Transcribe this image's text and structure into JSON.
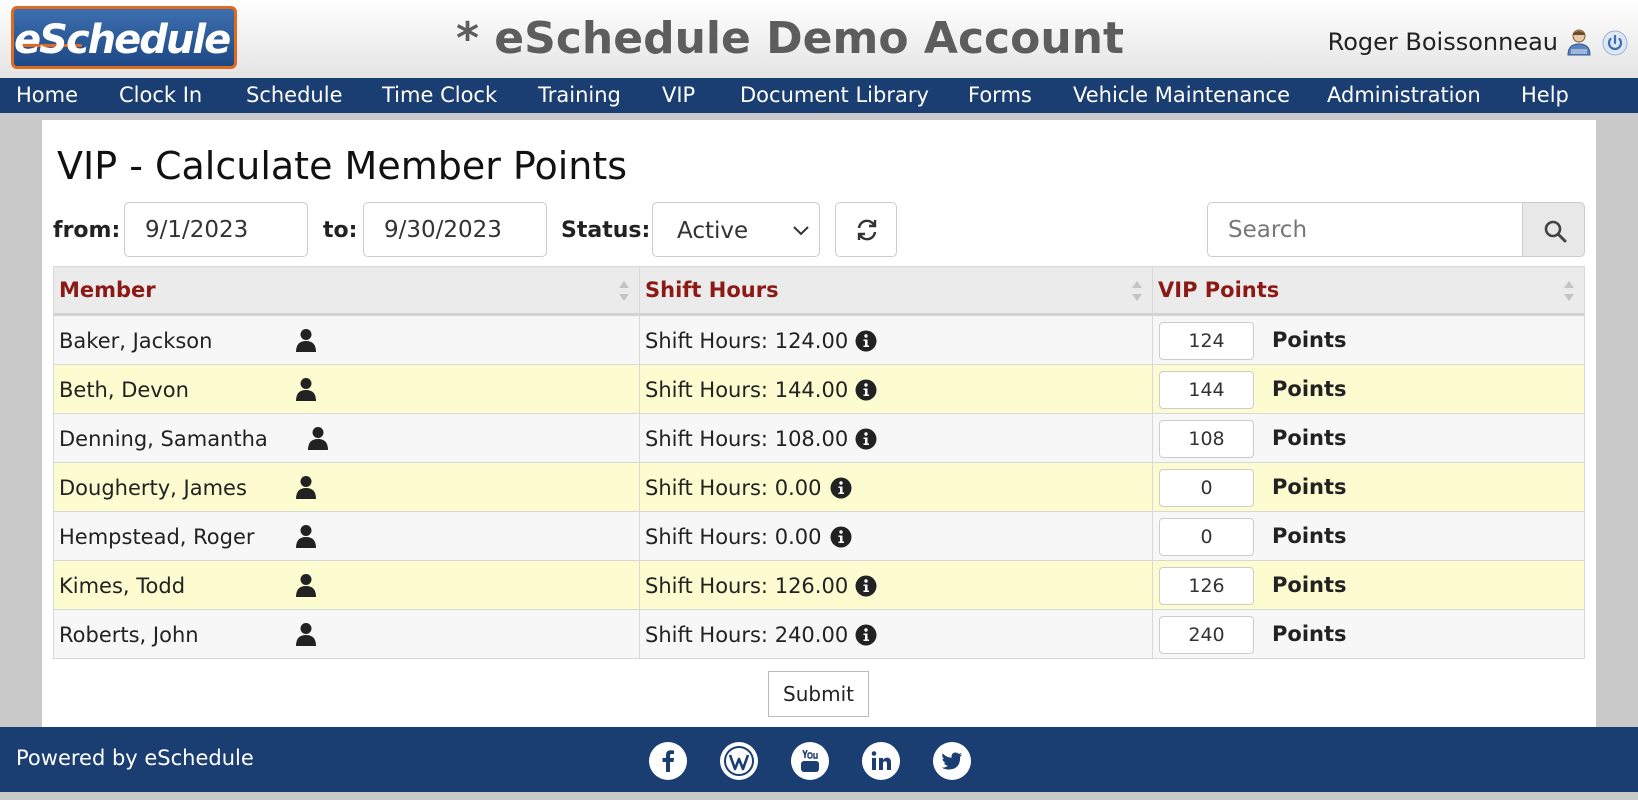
{
  "header": {
    "logo_text": "eSchedule",
    "app_title": "* eSchedule Demo Account",
    "user_name": "Roger Boissonneau",
    "user_icon": "user-avatar-icon",
    "power_icon": "power-icon"
  },
  "nav": {
    "items": [
      {
        "label": "Home"
      },
      {
        "label": "Clock In"
      },
      {
        "label": "Schedule"
      },
      {
        "label": "Time Clock"
      },
      {
        "label": "Training"
      },
      {
        "label": "VIP"
      },
      {
        "label": "Document Library"
      },
      {
        "label": "Forms"
      },
      {
        "label": "Vehicle Maintenance"
      },
      {
        "label": "Administration"
      },
      {
        "label": "Help"
      }
    ]
  },
  "page": {
    "title": "VIP - Calculate Member Points"
  },
  "filters": {
    "from_label": "from:",
    "from_value": "9/1/2023",
    "to_label": "to:",
    "to_value": "9/30/2023",
    "status_label": "Status:",
    "status_value": "Active",
    "search_placeholder": "Search"
  },
  "table": {
    "headers": {
      "member": "Member",
      "shift_hours": "Shift Hours",
      "vip_points": "VIP Points"
    },
    "hours_prefix": "Shift Hours:",
    "points_label": "Points",
    "rows": [
      {
        "member": "Baker, Jackson",
        "hours": "124.00",
        "points": "124"
      },
      {
        "member": "Beth, Devon",
        "hours": "144.00",
        "points": "144"
      },
      {
        "member": "Denning, Samantha",
        "hours": "108.00",
        "points": "108"
      },
      {
        "member": "Dougherty, James",
        "hours": "0.00",
        "points": "0"
      },
      {
        "member": "Hempstead, Roger",
        "hours": "0.00",
        "points": "0"
      },
      {
        "member": "Kimes, Todd",
        "hours": "126.00",
        "points": "126"
      },
      {
        "member": "Roberts, John",
        "hours": "240.00",
        "points": "240"
      }
    ]
  },
  "submit_label": "Submit",
  "footer": {
    "powered_by": "Powered by eSchedule",
    "social": [
      "facebook-icon",
      "wordpress-icon",
      "youtube-icon",
      "linkedin-icon",
      "twitter-icon"
    ]
  },
  "colors": {
    "nav_bg": "#1b3e72",
    "header_text": "#5d5d5d",
    "table_header_text": "#8b1a16",
    "row_highlight": "#fdfbd0",
    "logo_border": "#e06a1f"
  }
}
